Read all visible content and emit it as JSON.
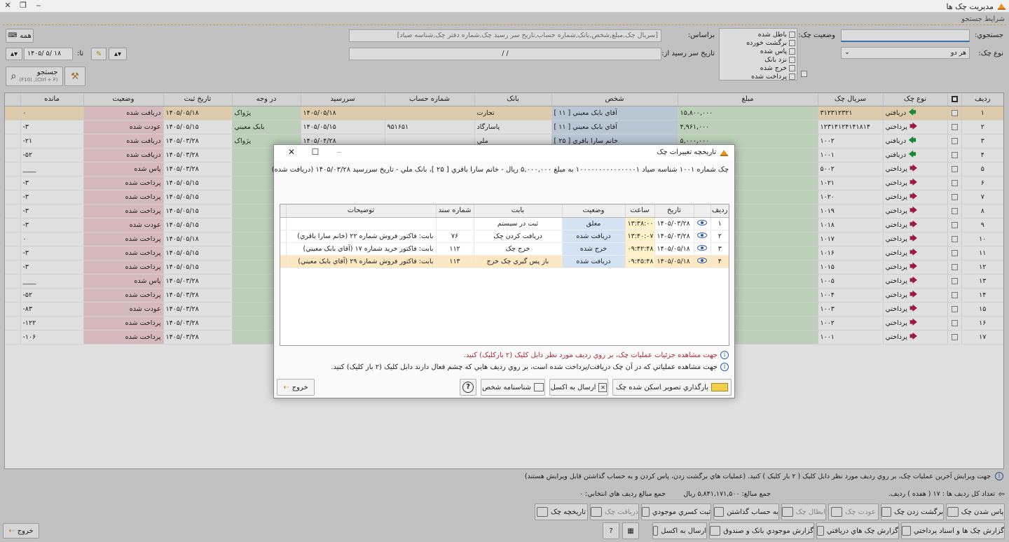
{
  "window": {
    "title": "مديريت چک ها"
  },
  "search": {
    "section_label": "شرايط جستجو",
    "query_label": "جستجوي:",
    "query_value": "",
    "based_on_label": "براساس:",
    "based_on_value": "[سريال چک,مبلغ,شخص,بانک,شماره حساب,تاريخ سر رسيد چک,شماره دفتر چک,شناسه صياد]",
    "all_button": "همه",
    "check_type_label": "نوع چک:",
    "check_type_value": "هر دو",
    "due_from_label": "تاريخ سر رسيد از:",
    "due_from_value": "/    /",
    "due_to_label": "تا:",
    "due_to_value": "۱۴۰۵/ ۵/ ۱۸",
    "status_label": "وضعيت چک:",
    "status_options": [
      "باطل شده",
      "برگشت خورده",
      "پاس شده",
      "نزد بانک",
      "خرج شده",
      "پرداخت شده"
    ],
    "search_button": "جستجو",
    "search_shortcut": "(Ctrl + F), (F10)"
  },
  "grid": {
    "columns": [
      "رديف",
      "",
      "نوع چک",
      "سريال چک",
      "مبلغ",
      "شخص",
      "بانک",
      "شماره حساب",
      "سررسيد",
      "در وجه",
      "تاريخ ثبت",
      "وضعيت",
      "مانده"
    ],
    "rows": [
      {
        "n": "۱",
        "type": "دريافتي",
        "dir": "in",
        "serial": "۳۱۲۳۱۲۳۲۱",
        "amount": "۱۵,۸۰۰,۰۰۰",
        "person": "آقاي بابک معيني [ ۱۱ ]",
        "bank": "تجارت",
        "account": "",
        "due": "۱۴۰۵/۰۵/۱۸",
        "payee": "پژواک",
        "reg": "۱۴۰۵/۰۵/۱۸",
        "status": "دريافت شده",
        "bal": "۰"
      },
      {
        "n": "۲",
        "type": "پرداختي",
        "dir": "out",
        "serial": "۱۲۳۱۴۱۲۴۱۴۱۸۱۴",
        "amount": "۴,۹۶۱,۰۰۰",
        "person": "آقاي بابک معيني [ ۱۱ ]",
        "bank": "پاسارگاد",
        "account": "۹۵۱۶۵۱",
        "due": "۱۴۰۵/۰۵/۱۵",
        "payee": "بابک معيني",
        "reg": "۱۴۰۵/۰۵/۱۵",
        "status": "عودت شده",
        "bal": "-۳"
      },
      {
        "n": "۳",
        "type": "دريافتي",
        "dir": "in",
        "serial": "۱۰۰۲",
        "amount": "۵,۰۰۰,۰۰۰",
        "person": "خانم سارا باقري [ ۲۵ ]",
        "bank": "ملي",
        "account": "",
        "due": "۱۴۰۵/۰۴/۲۸",
        "payee": "پژواک",
        "reg": "۱۴۰۵/۰۳/۲۸",
        "status": "دريافت شده",
        "bal": "-۲۱"
      },
      {
        "n": "۴",
        "type": "دريافتي",
        "dir": "in",
        "serial": "۱۰۰۱",
        "amount": "۵,۰۰۰,۰۰۰",
        "person": "",
        "bank": "",
        "account": "",
        "due": "",
        "payee": "",
        "reg": "۱۴۰۵/۰۳/۲۸",
        "status": "دريافت شده",
        "bal": "-۵۲"
      },
      {
        "n": "۵",
        "type": "پرداختي",
        "dir": "out",
        "serial": "۵۰۰۲",
        "amount": "۸۰,۰۰۰,۰۰۰",
        "person": "",
        "bank": "",
        "account": "",
        "due": "",
        "payee": "",
        "reg": "۱۴۰۵/۰۳/۲۸",
        "status": "پاس شده",
        "bal": "____"
      },
      {
        "n": "۶",
        "type": "پرداختي",
        "dir": "out",
        "serial": "۱۰۲۱",
        "amount": "۱,۰۰۰,۰۰۰,۰۰۰",
        "person": "",
        "bank": "",
        "account": "",
        "due": "",
        "payee": "",
        "reg": "۱۴۰۵/۰۵/۱۵",
        "status": "پرداخت شده",
        "bal": "-۳"
      },
      {
        "n": "۷",
        "type": "پرداختي",
        "dir": "out",
        "serial": "۱۰۲۰",
        "amount": "۲,۰۰۰,۰۰۰,۰۰۰",
        "person": "",
        "bank": "",
        "account": "",
        "due": "",
        "payee": "",
        "reg": "۱۴۰۵/۰۵/۱۵",
        "status": "پرداخت شده",
        "bal": "-۳"
      },
      {
        "n": "۸",
        "type": "پرداختي",
        "dir": "out",
        "serial": "۱۰۱۹",
        "amount": "۱,۰۰۰,۰۰۰,۰۰۰",
        "person": "",
        "bank": "",
        "account": "",
        "due": "",
        "payee": "",
        "reg": "۱۴۰۵/۰۵/۱۵",
        "status": "پرداخت شده",
        "bal": "-۳"
      },
      {
        "n": "۹",
        "type": "پرداختي",
        "dir": "out",
        "serial": "۱۰۱۸",
        "amount": "۱۰۰,۰۰۰,۰۰۰",
        "person": "",
        "bank": "",
        "account": "",
        "due": "",
        "payee": "",
        "reg": "۱۴۰۵/۰۵/۱۵",
        "status": "عودت شده",
        "bal": "-۳"
      },
      {
        "n": "۱۰",
        "type": "پرداختي",
        "dir": "out",
        "serial": "۱۰۱۷",
        "amount": "۳,۸۹۳,۰۰۰",
        "person": "",
        "bank": "",
        "account": "",
        "due": "",
        "payee": "",
        "reg": "۱۴۰۵/۰۵/۱۸",
        "status": "پرداخت شده",
        "bal": "۰"
      },
      {
        "n": "۱۱",
        "type": "پرداختي",
        "dir": "out",
        "serial": "۱۰۱۶",
        "amount": "۲۰۹,۰۰۰,۰۰۰",
        "person": "",
        "bank": "",
        "account": "",
        "due": "",
        "payee": "",
        "reg": "۱۴۰۵/۰۵/۱۵",
        "status": "پرداخت شده",
        "bal": "-۳"
      },
      {
        "n": "۱۲",
        "type": "پرداختي",
        "dir": "out",
        "serial": "۱۰۱۵",
        "amount": "۱,۰۰۰,۰۰۰,۰۰۰",
        "person": "",
        "bank": "",
        "account": "",
        "due": "",
        "payee": "",
        "reg": "۱۴۰۵/۰۵/۱۵",
        "status": "پرداخت شده",
        "bal": "-۳"
      },
      {
        "n": "۱۳",
        "type": "پرداختي",
        "dir": "out",
        "serial": "۱۰۰۵",
        "amount": "۲۰,۰۰۰,۰۰۰",
        "person": "",
        "bank": "",
        "account": "",
        "due": "",
        "payee": "",
        "reg": "۱۴۰۵/۰۳/۲۸",
        "status": "پاس شده",
        "bal": "____"
      },
      {
        "n": "۱۴",
        "type": "پرداختي",
        "dir": "out",
        "serial": "۱۰۰۴",
        "amount": "۲۰,۰۰۰,۰۰۰",
        "person": "",
        "bank": "",
        "account": "",
        "due": "",
        "payee": "",
        "reg": "۱۴۰۵/۰۳/۲۸",
        "status": "پرداخت شده",
        "bal": "-۵۲"
      },
      {
        "n": "۱۵",
        "type": "پرداختي",
        "dir": "out",
        "serial": "۱۰۰۳",
        "amount": "۳۰۰,۰۰۰,۰۰۰",
        "person": "",
        "bank": "",
        "account": "",
        "due": "",
        "payee": "",
        "reg": "۱۴۰۵/۰۳/۲۸",
        "status": "عودت شده",
        "bal": "-۸۳"
      },
      {
        "n": "۱۶",
        "type": "پرداختي",
        "dir": "out",
        "serial": "۱۰۰۲",
        "amount": "۷۷,۰۰۰,۰۰۰",
        "person": "",
        "bank": "",
        "account": "",
        "due": "",
        "payee": "",
        "reg": "۱۴۰۵/۰۳/۲۸",
        "status": "پرداخت شده",
        "bal": "-۱۲۲"
      },
      {
        "n": "۱۷",
        "type": "پرداختي",
        "dir": "out",
        "serial": "۱۰۰۱",
        "amount": "۵۱۷,۵۰۰",
        "person": "",
        "bank": "",
        "account": "",
        "due": "",
        "payee": "",
        "reg": "۱۴۰۵/۰۳/۲۸",
        "status": "پرداخت شده",
        "bal": "-۱۰۶"
      }
    ]
  },
  "status": {
    "edit_hint": "جهت ويرايش آخرين عمليات چک، بر روي رديف مورد نظر دابل کليک ( ۲ بار کليک ) کنيد. (عمليات هاي برگشت زدن، پاس کردن و به حساب گذاشتن قابل ويرايش هستند)",
    "row_count": "تعداد کل رديف ها : ۱۷ ( هفده ) رديف.",
    "sum_amounts": "جمع مبالغ: ۵,۸۴۱,۱۷۱,۵۰۰ ريال",
    "sum_selected": "جمع مبالغ رديف هاي انتخابي: ۰"
  },
  "actions": {
    "row1": [
      "پاس شدن چک",
      "برگشت زدن چک",
      "عودت چک",
      "ابطال چک",
      "به حساب گذاشتن",
      "ثبت کسري موجودي",
      "دريافت چک",
      "تاريخچه چک"
    ],
    "row2": [
      "گزارش چک ها و اسناد پرداختي",
      "گزارش چک هاي دريافتي",
      "گزارش موجودي بانک و صندوق",
      "ارسال به اکسل"
    ],
    "exit": "خروج"
  },
  "dialog": {
    "title": "تاريخچه تغييرات چک",
    "summary": "چک شماره ۱۰۰۱ شناسه صياد ۱۰۰۰۰۰۰۰۰۰۰۰۰۰۰۰۱ به مبلغ ۵,۰۰۰,۰۰۰ ريال - خانم سارا باقري [ ۲۵ ]، بانک ملي - تاريخ سررسيد ۱۴۰۵/۰۳/۲۸ (دريافت شده)",
    "columns": [
      "رديف",
      "",
      "تاريخ",
      "ساعت",
      "وضعيت",
      "بابت",
      "شماره سند",
      "توضيحات"
    ],
    "rows": [
      {
        "n": "۱",
        "date": "۱۴۰۵/۰۳/۲۸",
        "time": "۱۳:۳۸:۰۰",
        "state": "معلق",
        "reason": "ثبت در سيستم",
        "doc": "",
        "desc": ""
      },
      {
        "n": "۲",
        "date": "۱۴۰۵/۰۳/۲۸",
        "time": "۱۳:۴۰:۰۷",
        "state": "دريافت شده",
        "reason": "دريافت کردن چک",
        "doc": "۷۶",
        "desc": "بابت: فاکتور فروش شماره ۲۲ (خانم سارا باقري)"
      },
      {
        "n": "۳",
        "date": "۱۴۰۵/۰۵/۱۸",
        "time": "۰۹:۴۲:۴۸",
        "state": "خرج شده",
        "reason": "خرج چک",
        "doc": "۱۱۲",
        "desc": "بابت: فاکتور خريد شماره ۱۷ (آقاي بابک معيني)"
      },
      {
        "n": "۴",
        "date": "۱۴۰۵/۰۵/۱۸",
        "time": "۰۹:۴۵:۴۸",
        "state": "دريافت شده",
        "reason": "باز پس گيري چک خرج",
        "doc": "۱۱۳",
        "desc": "بابت: فاکتور فروش شماره ۲۹ (آقاي بابک معيني)"
      }
    ],
    "hint1": "جهت مشاهده جزئيات عمليات چک، بر روي رديف مورد نظر دابل کليک (۲ بارکليک) کنيد.",
    "hint2": "جهت مشاهده عملياتي که در آن چک دريافت/پرداخت شده است، بر روي رديف هايي که چشم فعال دارند دابل کليک (۲ بار کليک) کنيد.",
    "buttons": {
      "upload": "بارگذاري تصوير اسکن شده چک",
      "excel": "ارسال به اکسل",
      "person": "شناسنامه شخص",
      "help": "?",
      "exit": "خروج"
    }
  },
  "colors": {
    "status_red": "#f3d3d6",
    "blue_cell": "#d3e3f3",
    "green_cell": "#d6edd3",
    "yellow_cell": "#fff2c8",
    "selected_row": "#fde8c4"
  }
}
